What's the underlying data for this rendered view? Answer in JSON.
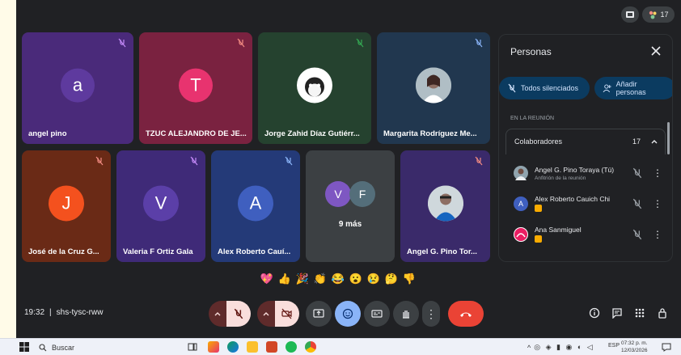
{
  "meeting": {
    "time": "19:32",
    "separator": "|",
    "code": "shs-tysc-rww",
    "participant_count": "17"
  },
  "tiles": [
    {
      "name": "angel pino",
      "initial": "a",
      "bg": "#4a2a7a",
      "avatar": "#5e3a9e"
    },
    {
      "name": "TZUC ALEJANDRO DE JE...",
      "initial": "T",
      "bg": "#7a2240",
      "avatar": "#e8336f"
    },
    {
      "name": "Jorge Zahid Díaz Gutiérr...",
      "initial": "",
      "bg": "#25422f",
      "avatar": "#ffffff",
      "mute_color": "#34a853"
    },
    {
      "name": "Margarita Rodríguez Me...",
      "initial": "",
      "bg": "#21374f",
      "avatar": "#cfd8dc"
    },
    {
      "name": "José de la Cruz G...",
      "initial": "J",
      "bg": "#6a2a16",
      "avatar": "#f4511e"
    },
    {
      "name": "Valeria F Ortiz Gala",
      "initial": "V",
      "bg": "#3f2a78",
      "avatar": "#5b3fa8"
    },
    {
      "name": "Alex Roberto Cauí...",
      "initial": "A",
      "bg": "#243a78",
      "avatar": "#3f5fbf"
    },
    {
      "name": "Angel G. Pino Tor...",
      "initial": "",
      "bg": "#3a2a6a",
      "avatar": "#cfd8dc"
    }
  ],
  "more_tile": {
    "label": "9 más",
    "initials": [
      "V",
      "F"
    ],
    "colors": [
      "#7e57c2",
      "#546e7a"
    ]
  },
  "reactions": [
    "💖",
    "👍",
    "🎉",
    "👏",
    "😂",
    "😮",
    "😢",
    "🤔",
    "👎"
  ],
  "panel": {
    "title": "Personas",
    "mute_all": "Todos silenciados",
    "add_people": "Añadir personas",
    "section": "EN LA REUNIÓN",
    "group": "Colaboradores",
    "group_count": "17",
    "people": [
      {
        "name": "Angel G. Pino Toraya (Tú)",
        "sub": "Anfitrión de la reunión",
        "initial": "",
        "color": "#90a4ae"
      },
      {
        "name": "Alex Roberto Cauich Chi",
        "sub": "",
        "initial": "A",
        "color": "#3f5fbf"
      },
      {
        "name": "Ana Sanmiguel",
        "sub": "",
        "initial": "",
        "color": "#e91e63"
      }
    ]
  },
  "taskbar": {
    "search": "Buscar",
    "lang": "ESP",
    "clock_time": "07:32 p. m.",
    "clock_date": "12/03/2026"
  },
  "colors": {
    "accent": "#8ab4f8",
    "danger": "#ea4335",
    "muted_red": "#f28b82"
  }
}
